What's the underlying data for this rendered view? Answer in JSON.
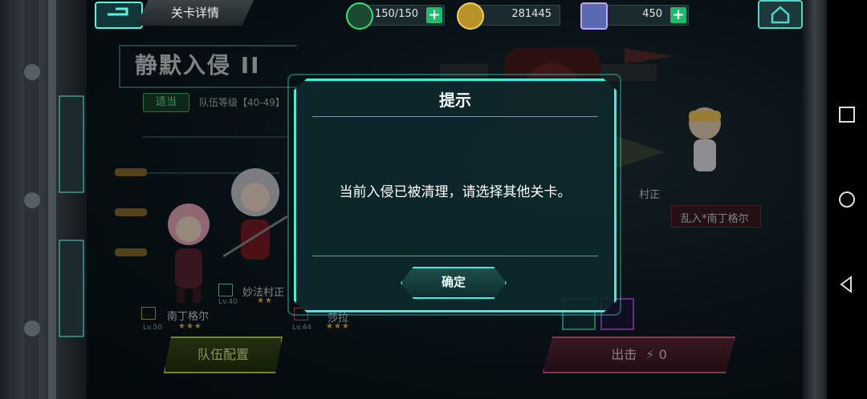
{
  "topbar": {
    "title": "关卡详情",
    "stamina": "150/150",
    "gold": "281445",
    "gems": "450",
    "plus": "+"
  },
  "stage": {
    "name": "静默入侵 II",
    "suitability": "适当",
    "level_range": "队伍等级【40-49】"
  },
  "team": [
    {
      "name": "南丁格尔",
      "level": "Lv.50",
      "stars": "★★★"
    },
    {
      "name": "妙法村正",
      "level": "Lv.40",
      "stars": "★★"
    },
    {
      "name": "莎拉",
      "level": "Lv.44",
      "stars": "★★★"
    }
  ],
  "enemies": [
    {
      "name": "村正"
    },
    {
      "name": "乱入*南丁格尔"
    }
  ],
  "buttons": {
    "team_config": "队伍配置",
    "start": "出击",
    "start_cost": "0"
  },
  "dialog": {
    "title": "提示",
    "message": "当前入侵已被清理，请选择其他关卡。",
    "confirm": "确定"
  },
  "icons": {
    "back": "back-arrow-icon",
    "stamina": "lightning-icon",
    "gold": "coin-icon",
    "gems": "cube-icon",
    "home": "home-icon"
  },
  "colors": {
    "accent": "#38f2de",
    "team_button": "#b6e03a",
    "start_button": "#e2587e",
    "plus": "#23b86e"
  }
}
